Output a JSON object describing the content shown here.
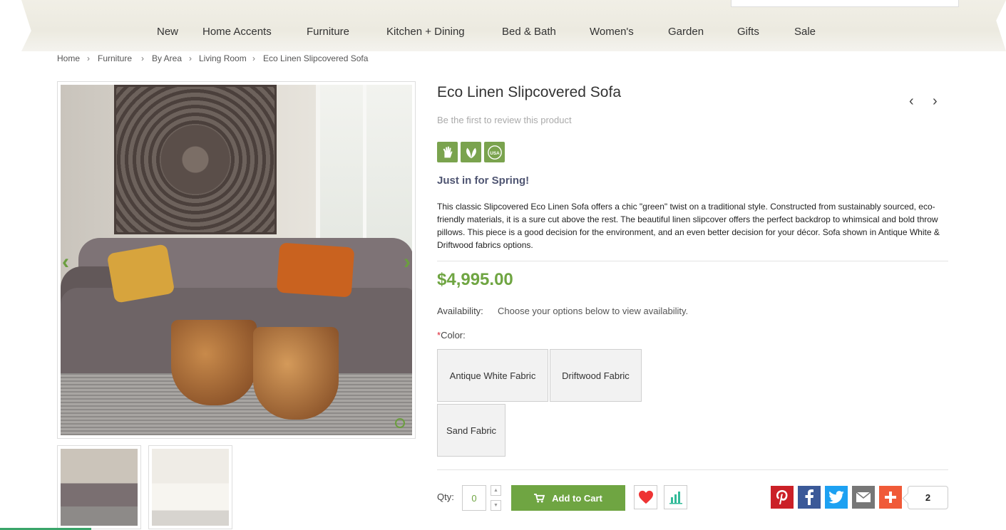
{
  "nav": {
    "items": [
      "New",
      "Home Accents",
      "Furniture",
      "Kitchen + Dining",
      "Bed & Bath",
      "Women's",
      "Garden",
      "Gifts",
      "Sale"
    ]
  },
  "breadcrumb": [
    "Home",
    "Furniture",
    "By Area",
    "Living Room",
    "Eco Linen Slipcovered Sofa"
  ],
  "product": {
    "title": "Eco Linen Slipcovered Sofa",
    "review_link": "Be the first to review this product",
    "badges": [
      "handmade-icon",
      "eco-leaf-icon",
      "usa-icon"
    ],
    "usa_badge_text": "USA",
    "tagline": "Just in for Spring!",
    "description": "This classic Slipcovered Eco Linen Sofa offers a chic \"green\" twist on a traditional style. Constructed from sustainably sourced, eco-friendly materials, it is a sure cut above the rest. The beautiful linen slipcover offers the perfect backdrop to whimsical and bold throw pillows. This piece is a good decision for the environment, and an even better decision for your décor. Sofa shown in Antique White & Driftwood fabrics options.",
    "price": "$4,995.00",
    "availability_label": "Availability:",
    "availability_value": "Choose your options below to view availability.",
    "color_label": "Color:",
    "required_mark": "*",
    "color_options": [
      "Antique White Fabric",
      "Driftwood Fabric",
      "Sand Fabric"
    ]
  },
  "purchase": {
    "qty_label": "Qty:",
    "qty_value": "0",
    "add_to_cart": "Add to Cart",
    "share_count": "2"
  },
  "colors": {
    "accent_green": "#6fa542",
    "tagline_color": "#4f5572",
    "pinterest": "#cb2027",
    "facebook": "#3b5998",
    "twitter": "#1da1f2",
    "email": "#777777",
    "more": "#f05a38"
  }
}
